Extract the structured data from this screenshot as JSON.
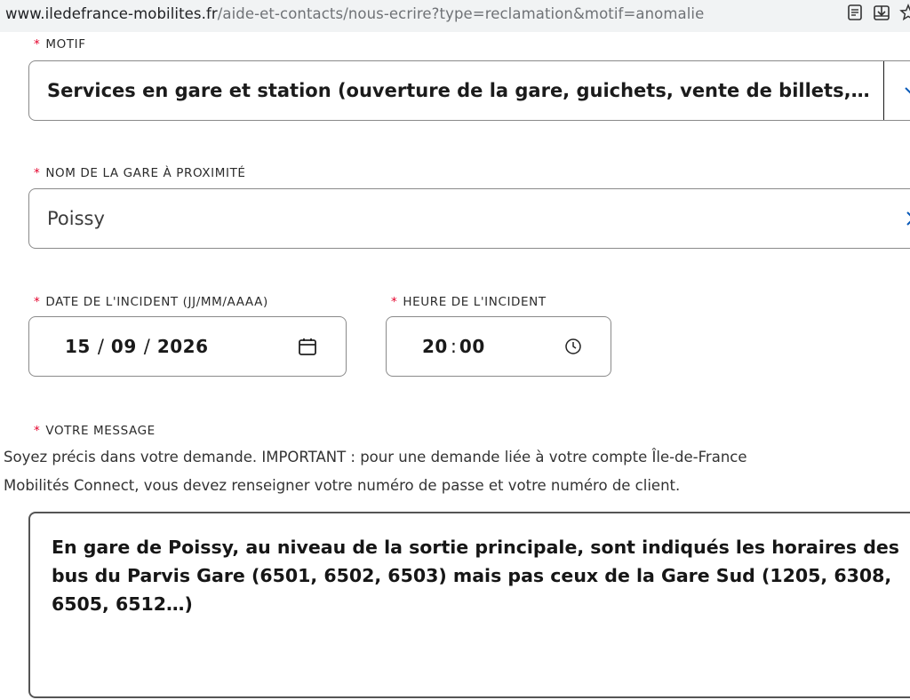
{
  "browser": {
    "url_domain": "www.iledefrance-mobilites.fr",
    "url_path": "/aide-et-contacts/nous-ecrire?type=reclamation&motif=anomalie"
  },
  "form": {
    "required_marker": "*",
    "motif": {
      "label": "MOTIF",
      "value": "Services en gare et station (ouverture de la gare, guichets, vente de billets, équ…"
    },
    "station": {
      "label": "NOM DE LA GARE À PROXIMITÉ",
      "value": "Poissy"
    },
    "date": {
      "label": "DATE DE L'INCIDENT (JJ/MM/AAAA)",
      "day": "15",
      "month": "09",
      "year": "2026",
      "separator": "/"
    },
    "time": {
      "label": "HEURE DE L'INCIDENT",
      "hour": "20",
      "minute": "00",
      "separator": ":"
    },
    "message": {
      "label": "VOTRE MESSAGE",
      "help_line1": "Soyez précis dans votre demande. IMPORTANT : pour une demande liée à votre compte Île-de-France",
      "help_line2": "Mobilités Connect, vous devez renseigner votre numéro de passe et votre numéro de client.",
      "value": "En gare de Poissy, au niveau de la sortie principale, sont indiqués les horaires des bus du Parvis Gare (6501, 6502, 6503) mais pas ceux de la Gare Sud (1205, 6308, 6505, 6512…)"
    }
  },
  "colors": {
    "required": "#e4002b",
    "accent": "#0a5ab8",
    "border": "#8a8a8a"
  },
  "icons": {
    "reader": "reader-mode-icon",
    "download": "download-icon",
    "bookmark": "bookmark-star-icon",
    "chevron": "chevron-down-icon",
    "clear": "clear-icon",
    "calendar": "calendar-icon",
    "clock": "clock-icon"
  }
}
